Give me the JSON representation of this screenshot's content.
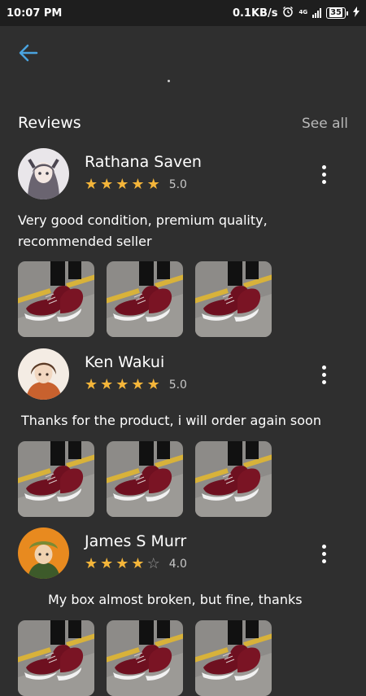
{
  "status_bar": {
    "time": "10:07 PM",
    "speed": "0.1KB/s",
    "network": "4G",
    "battery": "35"
  },
  "header": {
    "back_icon": "arrow-left-icon",
    "section_title": "Reviews",
    "see_all_label": "See all"
  },
  "colors": {
    "background": "#2f2f2f",
    "accent": "#4aa3df",
    "star": "#f4b53a"
  },
  "reviews": [
    {
      "name": "Rathana Saven",
      "rating": 5,
      "rating_label": "5.0",
      "text": "Very good condition, premium quality, recommended seller",
      "photos": [
        "shoe-photo",
        "shoe-photo",
        "shoe-photo"
      ]
    },
    {
      "name": "Ken Wakui",
      "rating": 5,
      "rating_label": "5.0",
      "text": "Thanks for the product, i will order again soon",
      "photos": [
        "shoe-photo",
        "shoe-photo",
        "shoe-photo"
      ]
    },
    {
      "name": "James S Murr",
      "rating": 4,
      "rating_label": "4.0",
      "text": "My box almost broken, but fine, thanks",
      "photos": [
        "shoe-photo",
        "shoe-photo",
        "shoe-photo"
      ]
    }
  ]
}
